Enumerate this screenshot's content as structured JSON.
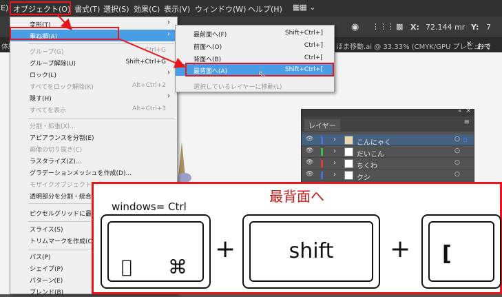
{
  "menubar": {
    "items": [
      "E)",
      "オブジェクト(O)",
      "書式(T)",
      "選択(S)",
      "効果(C)",
      "表示(V)",
      "ウィンドウ(W)",
      "ヘルプ(H)"
    ],
    "workspace_icon": "workspace-switcher-icon"
  },
  "toolbar": {
    "x_label": "X:",
    "x_value": "72.144 mr",
    "y_label": "Y:",
    "y_value": "7"
  },
  "tabs": {
    "tab1": "体験",
    "tab2": "ほま移動.ai @ 33.33% (CMYK/GPU プレビュー)",
    "tab3": "おでん.ai"
  },
  "object_menu": {
    "items": [
      {
        "label": "変形(T)",
        "shortcut": "",
        "submenu": true,
        "disabled": false
      },
      {
        "label": "重ね順(A)",
        "shortcut": "",
        "submenu": true,
        "disabled": false,
        "selected": true
      },
      {
        "label": "グループ(G)",
        "shortcut": "Ctrl+G",
        "submenu": false,
        "disabled": true
      },
      {
        "label": "グループ解除(U)",
        "shortcut": "Shift+Ctrl+G",
        "submenu": false,
        "disabled": false
      },
      {
        "label": "ロック(L)",
        "shortcut": "",
        "submenu": true,
        "disabled": false
      },
      {
        "label": "すべてをロック解除(K)",
        "shortcut": "Alt+Ctrl+2",
        "submenu": false,
        "disabled": true
      },
      {
        "label": "隠す(H)",
        "shortcut": "",
        "submenu": true,
        "disabled": false
      },
      {
        "label": "すべてを表示",
        "shortcut": "Alt+Ctrl+3",
        "submenu": false,
        "disabled": true
      },
      {
        "label": "分割・拡張(X)...",
        "shortcut": "",
        "submenu": false,
        "disabled": true
      },
      {
        "label": "アピアランスを分割(E)",
        "shortcut": "",
        "submenu": false,
        "disabled": false
      },
      {
        "label": "画像の切り抜き(C)",
        "shortcut": "",
        "submenu": false,
        "disabled": true
      },
      {
        "label": "ラスタライズ(Z)...",
        "shortcut": "",
        "submenu": false,
        "disabled": false
      },
      {
        "label": "グラデーションメッシュを作成(D)...",
        "shortcut": "",
        "submenu": false,
        "disabled": false
      },
      {
        "label": "モザイクオブジェクトを作",
        "shortcut": "",
        "submenu": false,
        "disabled": true
      },
      {
        "label": "透明部分を分割・統合",
        "shortcut": "",
        "submenu": false,
        "disabled": false
      },
      {
        "label": "ピクセルグリッドに最適化",
        "shortcut": "",
        "submenu": false,
        "disabled": false
      },
      {
        "label": "スライス(S)",
        "shortcut": "",
        "submenu": false,
        "disabled": false
      },
      {
        "label": "トリムマークを作成(C)",
        "shortcut": "",
        "submenu": false,
        "disabled": false
      },
      {
        "label": "パス(P)",
        "shortcut": "",
        "submenu": false,
        "disabled": false
      },
      {
        "label": "シェイプ(P)",
        "shortcut": "",
        "submenu": false,
        "disabled": false
      },
      {
        "label": "パターン(E)",
        "shortcut": "",
        "submenu": false,
        "disabled": false
      },
      {
        "label": "ブレンド(B)",
        "shortcut": "",
        "submenu": false,
        "disabled": false
      }
    ]
  },
  "arrange_submenu": {
    "items": [
      {
        "label": "最前面へ(F)",
        "shortcut": "Shift+Ctrl+]",
        "disabled": false
      },
      {
        "label": "前面へ(O)",
        "shortcut": "Ctrl+]",
        "disabled": false
      },
      {
        "label": "背面へ(B)",
        "shortcut": "Ctrl+[",
        "disabled": false
      },
      {
        "label": "最背面へ(A)",
        "shortcut": "Shift+Ctrl+[",
        "disabled": false,
        "selected": true
      },
      {
        "label": "選択しているレイヤーに移動(L)",
        "shortcut": "",
        "disabled": true
      }
    ]
  },
  "layers_panel": {
    "title": "レイヤー",
    "layers": [
      {
        "name": "こんにゃく",
        "color": "#4a6fd6",
        "selected": true
      },
      {
        "name": "だいこん",
        "color": "#3dbf4a",
        "selected": false
      },
      {
        "name": "ちくわ",
        "color": "#e03a3a",
        "selected": false
      },
      {
        "name": "クシ",
        "color": "#4a6fd6",
        "selected": false
      }
    ]
  },
  "shortcut_info": {
    "title": "最背面へ",
    "note": "windows= Ctrl",
    "plus": "+",
    "key_shift": "shift",
    "key_bracket": "["
  },
  "colors": {
    "highlight": "#e8161b",
    "selection": "#4a9ee6"
  }
}
